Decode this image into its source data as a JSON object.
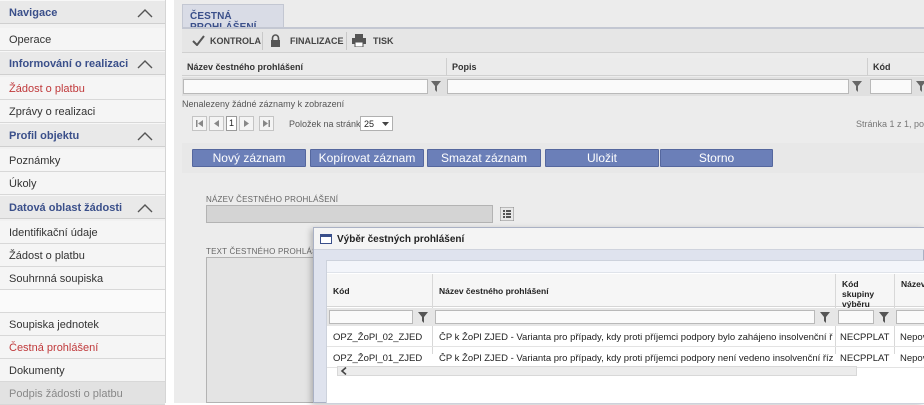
{
  "sidebar": {
    "sections": [
      {
        "label": "Navigace"
      },
      {
        "label": "Informování o realizaci"
      },
      {
        "label": "Profil objektu"
      },
      {
        "label": "Datová oblast žádosti"
      }
    ],
    "items": {
      "operace": "Operace",
      "zadost_o_platbu_1": "Žádost o platbu",
      "zpravy": "Zprávy o realizaci",
      "poznamky": "Poznámky",
      "ukoly": "Úkoly",
      "identifikacni": "Identifikační údaje",
      "zadost_o_platbu_2": "Žádost o platbu",
      "souhrnna": "Souhrnná soupiska",
      "blank": "",
      "soupiska_jednotek": "Soupiska jednotek",
      "cestna": "Čestná prohlášení",
      "dokumenty": "Dokumenty",
      "podpis": "Podpis žádosti o platbu"
    },
    "colors": {
      "section": "#3a4f8a",
      "active": "#c0393b"
    }
  },
  "main": {
    "tab_label": "ČESTNÁ PROHLÁŠENÍ",
    "toolbar": {
      "kontrola": "KONTROLA",
      "finalizace": "FINALIZACE",
      "tisk": "TISK"
    },
    "grid": {
      "columns": [
        "Název čestného prohlášení",
        "Popis",
        "Kód"
      ],
      "empty_text": "Nenalezeny žádné záznamy k zobrazení"
    },
    "pager": {
      "page": "1",
      "per_page_label": "Položek na stránku",
      "per_page_value": "25",
      "info": "Stránka 1 z 1, po"
    },
    "actions": {
      "novy": "Nový záznam",
      "kopirovat": "Kopírovat záznam",
      "smazat": "Smazat záznam",
      "ulozit": "Uložit",
      "storno": "Storno"
    },
    "form": {
      "nazev_label": "NÁZEV ČESTNÉHO PROHLÁŠENÍ",
      "text_label": "TEXT ČESTNÉHO PROHLÁŠENÍ"
    },
    "accent": "#6b7fb8"
  },
  "modal": {
    "title": "Výběr čestných prohlášení",
    "columns": {
      "kod": "Kód",
      "nazev": "Název čestného prohlášení",
      "skupina": "Kód skupiny výběru",
      "nazev_s": "Název s"
    },
    "rows": [
      {
        "kod": "OPZ_ŽoPl_02_ZJED",
        "nazev": "ČP k ŽoPl ZJED - Varianta pro případy, kdy proti příjemci podpory bylo zahájeno insolvenční ří...",
        "skupina": "NECPPLAT",
        "nazev_s": "Nepov"
      },
      {
        "kod": "OPZ_ŽoPl_01_ZJED",
        "nazev": "ČP k ŽoPl ZJED - Varianta pro případy, kdy proti příjemci podpory není vedeno insolvenční řízení",
        "skupina": "NECPPLAT",
        "nazev_s": "Nepov"
      }
    ]
  }
}
